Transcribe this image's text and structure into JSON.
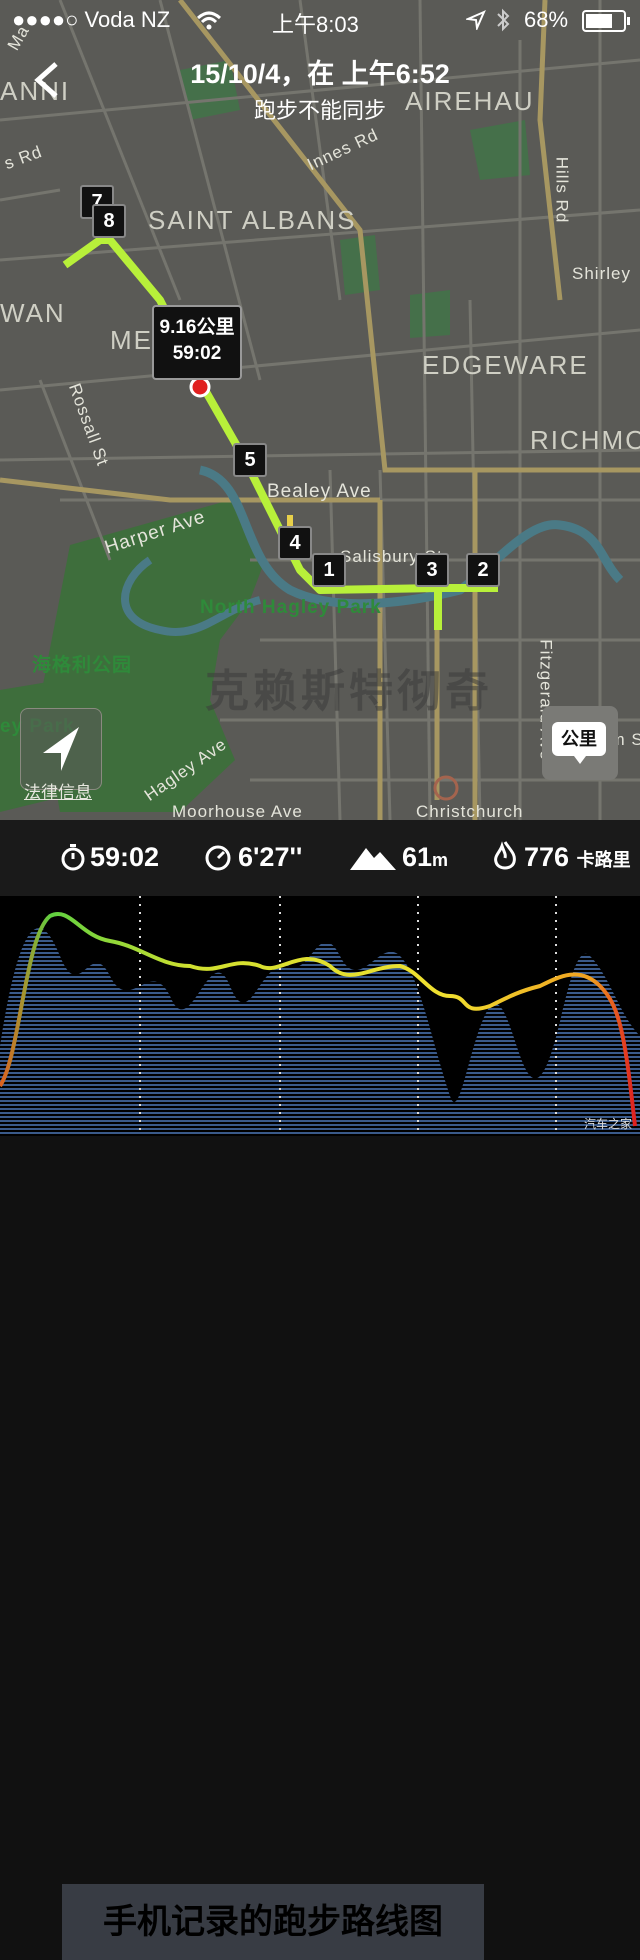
{
  "status": {
    "carrier": "●●●●○ Voda NZ",
    "time": "上午8:03",
    "battery": "68%"
  },
  "header": {
    "title": "15/10/4，在 上午6:52",
    "subtitle": "跑步不能同步"
  },
  "map": {
    "districts": [
      "SAINT ALBANS",
      "EDGEWARE",
      "RICHMO",
      "WAN",
      "ANNI",
      "AIREHAU",
      "ME"
    ],
    "streets": [
      "Innes Rd",
      "Hills Rd",
      "Shirley",
      "Rossall St",
      "Bealey Ave",
      "Harper Ave",
      "Salisbury St",
      "Fitzgerald Ave",
      "Hagley Ave",
      "Moorhouse Ave",
      "Christchurch",
      "Ma",
      "s Rd",
      "am S"
    ],
    "parks": [
      "North Hagley Park",
      "海格利公园",
      "ey Park"
    ],
    "city_watermark": "克赖斯特彻奇",
    "legal": "法律信息",
    "unit_button": "公里",
    "callout": {
      "distance": "9.16公里",
      "duration": "59:02"
    },
    "markers": [
      "7",
      "8",
      "5",
      "4",
      "1",
      "3",
      "2"
    ]
  },
  "stats": {
    "time": "59:02",
    "pace": "6'27''",
    "elevation": "61",
    "elevation_unit": "m",
    "calories": "776",
    "calories_unit": "卡路里"
  },
  "chart": {
    "caption": "手机记录的跑步路线图"
  },
  "watermark": "汽车之家",
  "colors": {
    "route": "#b8f03a",
    "map_bg": "#5a5a56",
    "park": "#3e6e3c",
    "river": "#4a7a86"
  }
}
